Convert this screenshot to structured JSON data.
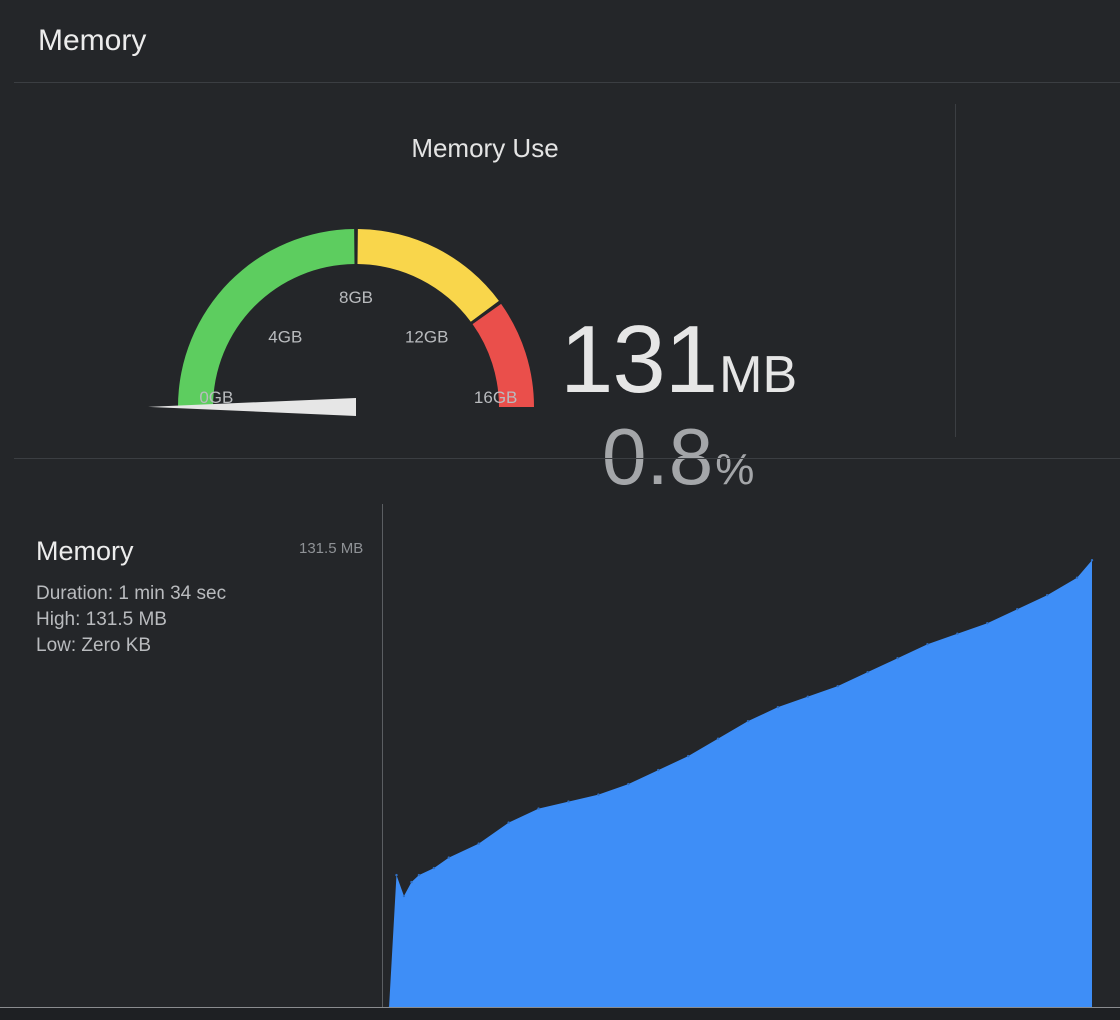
{
  "header": {
    "title": "Memory"
  },
  "gauge": {
    "title": "Memory Use",
    "labels": [
      "0GB",
      "4GB",
      "8GB",
      "12GB",
      "16GB"
    ],
    "max_gb": 16,
    "current_gb": 0.128,
    "colors": {
      "green": "#5dcd5f",
      "yellow": "#f9d64b",
      "red": "#ea4f4b",
      "needle": "#e6e6e6"
    }
  },
  "readout": {
    "value": "131",
    "value_unit": "MB",
    "percent": "0.8",
    "percent_unit": "%"
  },
  "stats": {
    "title": "Memory",
    "duration": "Duration: 1 min 34 sec",
    "high": "High: 131.5 MB",
    "low": "Low: Zero KB"
  },
  "chart_data": {
    "type": "area",
    "title": "",
    "xlabel": "",
    "ylabel": "",
    "max_label": "131.5 MB",
    "color": "#3e8ef7",
    "ylim": [
      0,
      131.5
    ],
    "x": [
      0,
      1,
      2,
      3,
      4,
      6,
      8,
      12,
      16,
      20,
      24,
      28,
      32,
      36,
      40,
      44,
      48,
      52,
      56,
      60,
      64,
      68,
      72,
      76,
      80,
      84,
      88,
      92,
      94
    ],
    "values": [
      0,
      38,
      32,
      36,
      38,
      40,
      43,
      47,
      53,
      57,
      59,
      61,
      64,
      68,
      72,
      77,
      82,
      86,
      89,
      92,
      96,
      100,
      104,
      107,
      110,
      114,
      118,
      123,
      128
    ]
  }
}
